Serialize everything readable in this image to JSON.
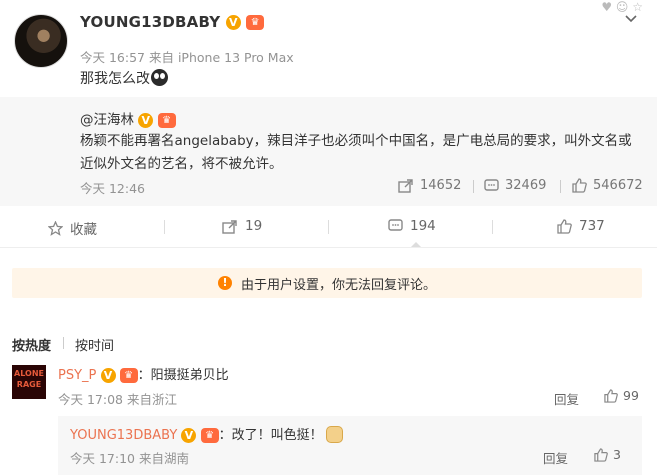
{
  "post": {
    "username": "YOUNG13DBABY",
    "verified_badge": "V",
    "time": "今天 16:57",
    "source": "来自 iPhone 13 Pro Max",
    "text": "那我怎么改"
  },
  "repost": {
    "mention": "@汪海林",
    "text": "杨颖不能再署名angelababy，辣目洋子也必须叫个中国名，是广电总局的要求，叫外文名或近似外文名的艺名，将不被允许。",
    "time": "今天 12:46",
    "shares": "14652",
    "comments": "32469",
    "likes": "546672"
  },
  "actions": {
    "favorite_label": "收藏",
    "share_count": "19",
    "comment_count": "194",
    "like_count": "737"
  },
  "notice": {
    "text": "由于用户设置，你无法回复评论。",
    "icon": "!"
  },
  "sort": {
    "by_heat": "按热度",
    "by_time": "按时间"
  },
  "comments": [
    {
      "name": "PSY_P",
      "text": "：阳摄挺弟贝比",
      "time": "今天 17:08 来自浙江",
      "reply_label": "回复",
      "likes": "99",
      "avatar_text": "ALONE RAGE"
    }
  ],
  "sub_reply": {
    "name": "YOUNG13DBABY",
    "text": "：改了！叫色挺！",
    "time": "今天 17:10 来自湖南",
    "reply_label": "回复",
    "likes": "3"
  },
  "colors": {
    "accent_orange": "#ff8200",
    "name_orange": "#eb7350",
    "notice_bg": "#fff5e8",
    "gray_bg": "#f7f7f7"
  }
}
